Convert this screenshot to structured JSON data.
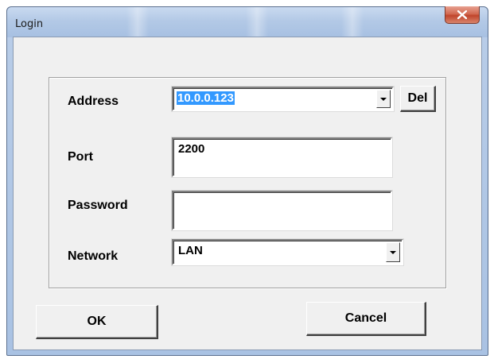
{
  "window": {
    "title": "Login"
  },
  "form": {
    "address_label": "Address",
    "address_value": "10.0.0.123",
    "del_label": "Del",
    "port_label": "Port",
    "port_value": "2200",
    "password_label": "Password",
    "password_value": "",
    "network_label": "Network",
    "network_value": "LAN"
  },
  "buttons": {
    "ok_label": "OK",
    "cancel_label": "Cancel"
  },
  "icons": {
    "close": "close-icon",
    "dropdown": "chevron-down-icon"
  },
  "colors": {
    "selection": "#3399ff",
    "close_button": "#c0452c",
    "dialog_bg": "#f0f0f0"
  }
}
